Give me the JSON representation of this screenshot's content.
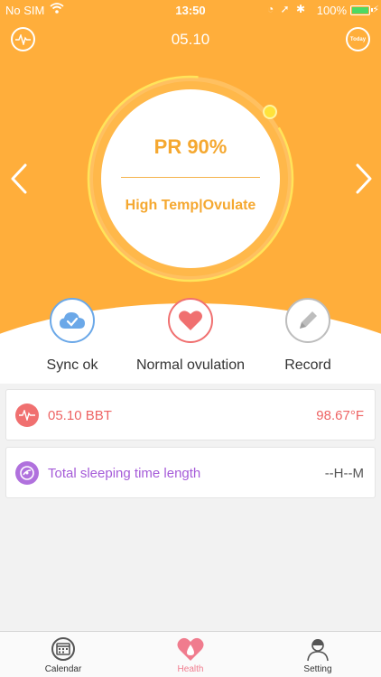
{
  "status_bar": {
    "carrier": "No SIM",
    "time": "13:50",
    "battery": "100%"
  },
  "nav": {
    "date": "05.10",
    "today_label": "Today"
  },
  "ring": {
    "title": "PR 90%",
    "subtitle": "High Temp|Ovulate"
  },
  "actions": {
    "sync": "Sync ok",
    "ovulation": "Normal ovulation",
    "record": "Record"
  },
  "cards": {
    "bbt": {
      "title": "05.10 BBT",
      "value": "98.67°F"
    },
    "sleep": {
      "title": "Total sleeping time length",
      "value": "--H--M"
    }
  },
  "tabs": {
    "calendar": "Calendar",
    "health": "Health",
    "setting": "Setting"
  },
  "colors": {
    "header": "#FFAE3B",
    "accent_text": "#F5A830",
    "bbt": "#EE6464",
    "sleep": "#A55BD8",
    "sync": "#6BA8E8",
    "health_tab": "#F07C8E"
  }
}
